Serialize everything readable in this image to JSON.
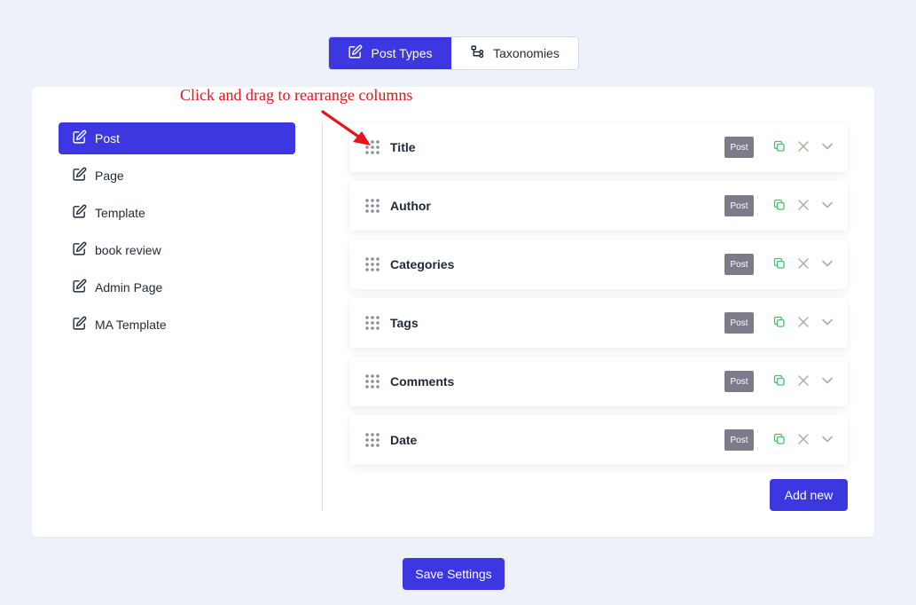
{
  "tabs": [
    {
      "label": "Post Types",
      "icon": "edit-icon",
      "active": true
    },
    {
      "label": "Taxonomies",
      "icon": "hierarchy-icon",
      "active": false
    }
  ],
  "annotation": "Click and drag to rearrange columns",
  "sidebar": {
    "items": [
      {
        "label": "Post",
        "active": true
      },
      {
        "label": "Page"
      },
      {
        "label": "Template"
      },
      {
        "label": "book review"
      },
      {
        "label": "Admin Page"
      },
      {
        "label": "MA Template"
      }
    ]
  },
  "columns": [
    {
      "label": "Title",
      "badge": "Post"
    },
    {
      "label": "Author",
      "badge": "Post"
    },
    {
      "label": "Categories",
      "badge": "Post"
    },
    {
      "label": "Tags",
      "badge": "Post"
    },
    {
      "label": "Comments",
      "badge": "Post"
    },
    {
      "label": "Date",
      "badge": "Post"
    }
  ],
  "buttons": {
    "add_new": "Add new",
    "save": "Save Settings"
  },
  "colors": {
    "accent": "#3c37e0",
    "annotation": "#e3141b",
    "copy_icon": "#3cc46a",
    "muted_icon": "#a8b0a0",
    "badge": "#7b7b8a"
  }
}
